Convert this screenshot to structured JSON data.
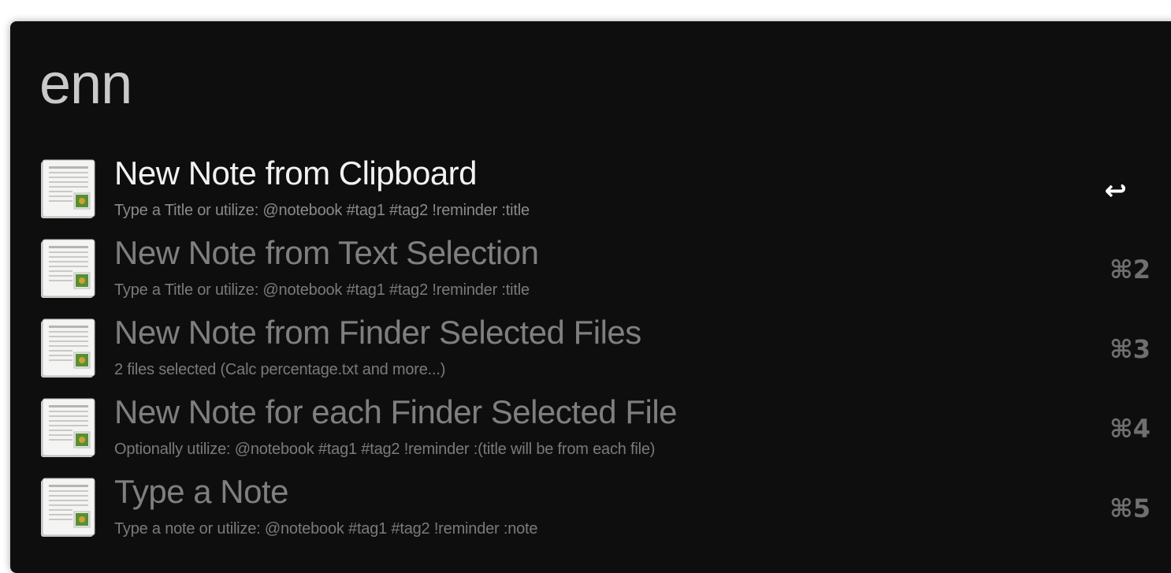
{
  "query": "enn",
  "results": [
    {
      "title": "New Note from Clipboard",
      "subtitle": "Type a Title or utilize: @notebook #tag1 #tag2 !reminder :title",
      "shortcut": "↩",
      "icon": "note-document-icon",
      "selected": true
    },
    {
      "title": "New Note from Text Selection",
      "subtitle": "Type a Title or utilize: @notebook #tag1 #tag2 !reminder :title",
      "shortcut": "⌘2",
      "icon": "note-document-icon",
      "selected": false
    },
    {
      "title": "New Note from Finder Selected Files",
      "subtitle": "2 files selected (Calc percentage.txt and more...)",
      "shortcut": "⌘3",
      "icon": "note-document-icon",
      "selected": false
    },
    {
      "title": "New Note for each Finder Selected File",
      "subtitle": "Optionally utilize: @notebook #tag1 #tag2 !reminder :(title will be from each file)",
      "shortcut": "⌘4",
      "icon": "note-document-icon",
      "selected": false
    },
    {
      "title": "Type a Note",
      "subtitle": "Type a note or utilize: @notebook #tag1 #tag2 !reminder :note",
      "shortcut": "⌘5",
      "icon": "note-document-icon",
      "selected": false
    }
  ],
  "colors": {
    "window_bg": "#0e0e0e",
    "query_text": "#c9c9c9",
    "selected_title": "#f2f2f2",
    "title": "#7f7f7f",
    "subtitle": "#7a7a7a"
  }
}
